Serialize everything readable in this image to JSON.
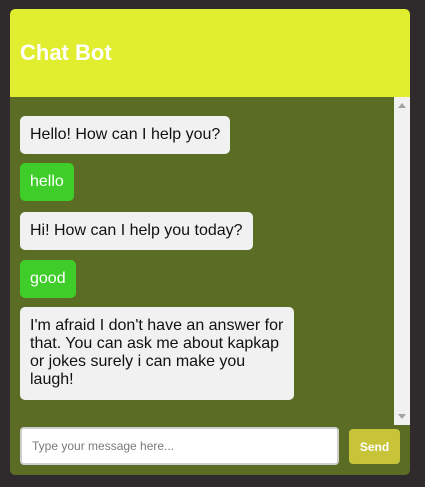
{
  "header": {
    "title": "Chat Bot"
  },
  "messages": [
    {
      "sender": "bot",
      "text": "Hello! How can I help you?"
    },
    {
      "sender": "user",
      "text": "hello"
    },
    {
      "sender": "bot",
      "text": "Hi! How can I help you today?"
    },
    {
      "sender": "user",
      "text": "good"
    },
    {
      "sender": "bot",
      "text": "I'm afraid I don't have an answer for that. You can ask me about kapkap or jokes surely i can make you laugh!"
    }
  ],
  "input": {
    "value": "",
    "placeholder": "Type your message here..."
  },
  "send_button": {
    "label": "Send"
  },
  "colors": {
    "page_background": "#2f2a2b",
    "header_background": "#e1ee30",
    "chat_background": "#5b6d24",
    "bot_bubble": "#f1f1f1",
    "user_bubble": "#3fcd2a",
    "send_button": "#c8c43a"
  },
  "icons": {
    "scroll_up": "scroll-up-arrow-icon",
    "scroll_down": "scroll-down-arrow-icon"
  }
}
